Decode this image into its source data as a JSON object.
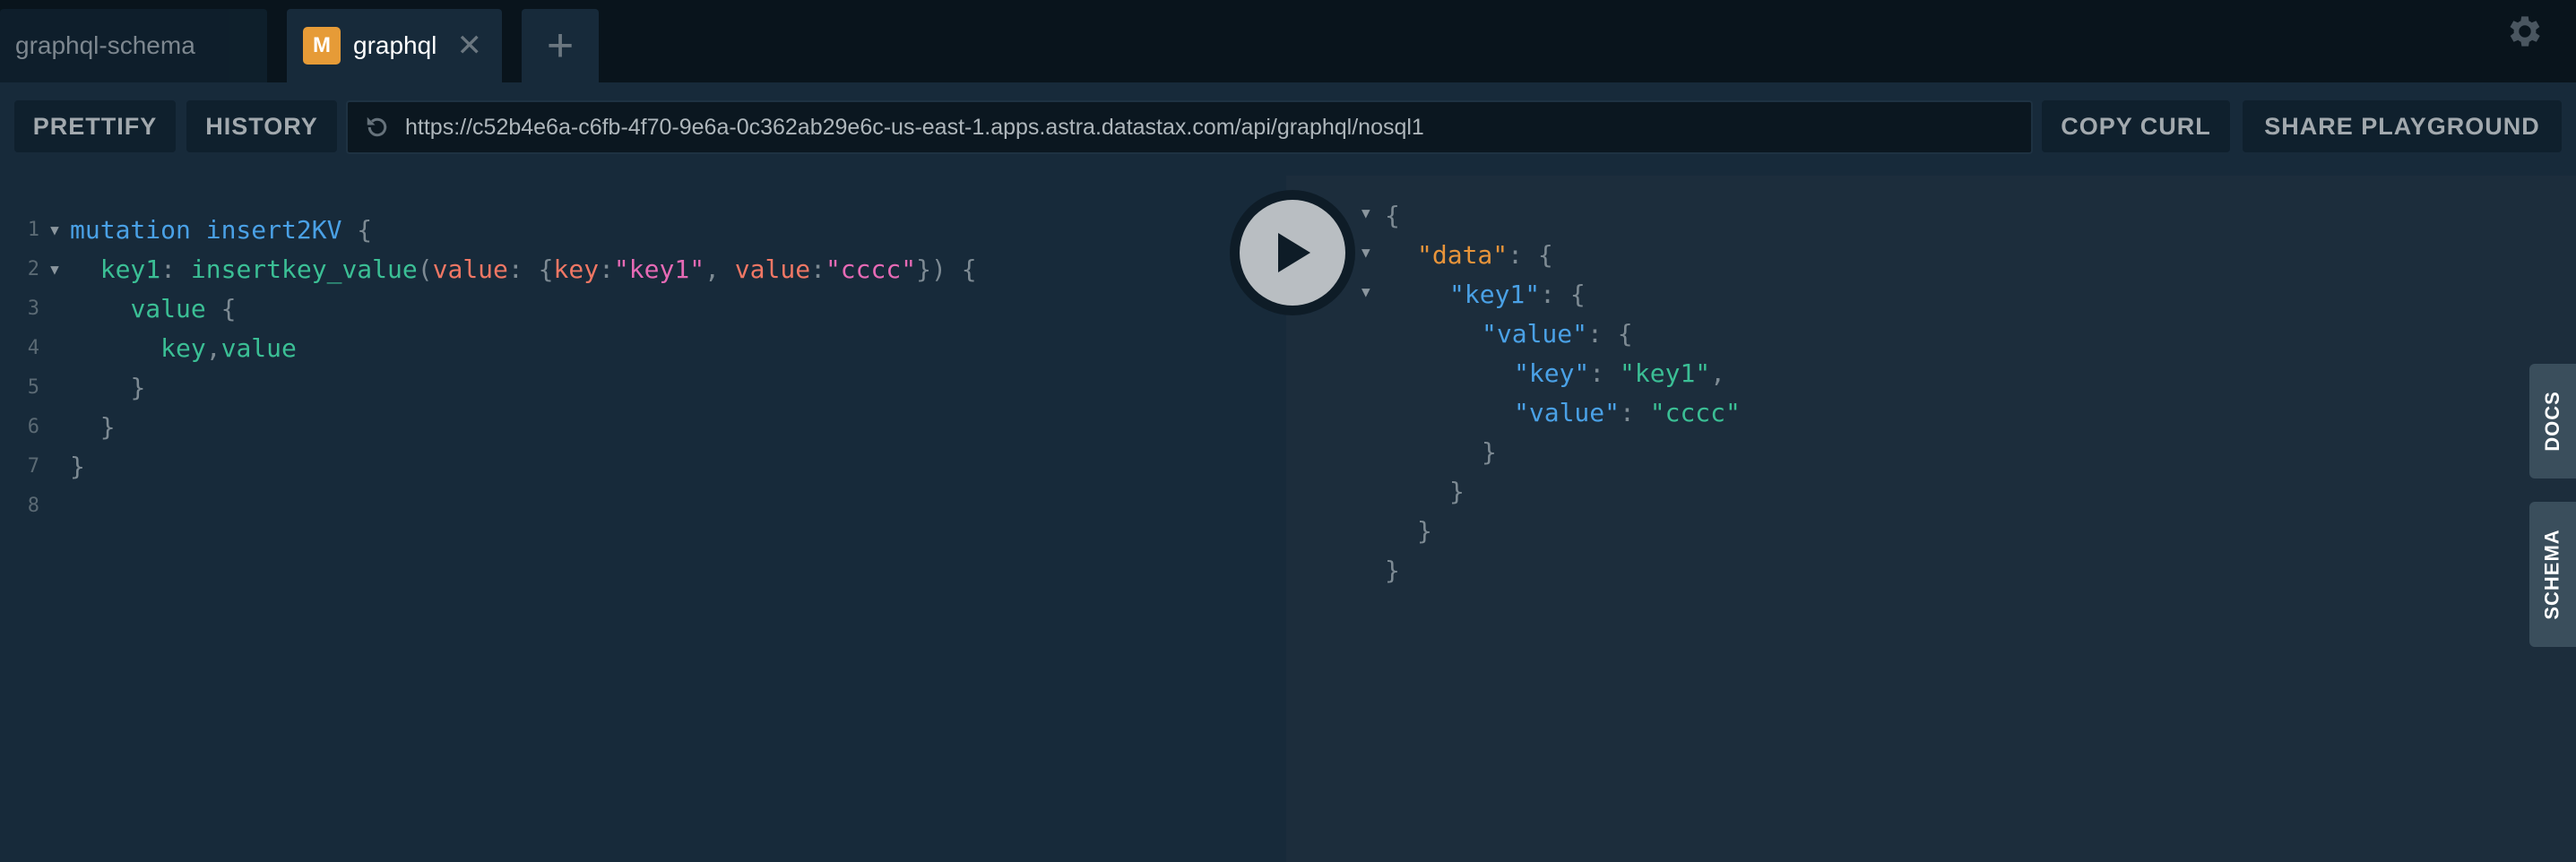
{
  "tabs": [
    {
      "label": "graphql-schema",
      "active": false
    },
    {
      "label": "graphql",
      "active": true,
      "badge": "M"
    }
  ],
  "tab_close_glyph": "✕",
  "add_tab_glyph": "+",
  "icons": {
    "settings": "gear-icon",
    "reload": "reload-icon",
    "play": "play-icon"
  },
  "toolbar": {
    "prettify": "PRETTIFY",
    "history": "HISTORY",
    "url": "https://c52b4e6a-c6fb-4f70-9e6a-0c362ab29e6c-us-east-1.apps.astra.datastax.com/api/graphql/nosql1",
    "copy_curl": "COPY CURL",
    "share": "SHARE PLAYGROUND"
  },
  "editor": {
    "line_numbers": [
      "1",
      "2",
      "3",
      "4",
      "5",
      "6",
      "7",
      "8"
    ],
    "l1": {
      "kw": "mutation",
      "name": "insert2KV",
      "brace": "{"
    },
    "l2": {
      "alias": "key1",
      "colon": ":",
      "field": "insertkey_value",
      "open": "(",
      "arg": "value",
      "argcolon": ":",
      "objopen": "{",
      "k": "key",
      "kc": ":",
      "kv": "\"key1\"",
      "comma": ",",
      "v": "value",
      "vc": ":",
      "vv": "\"cccc\"",
      "close": "})",
      "brace": "{"
    },
    "l3": {
      "field": "value",
      "brace": "{"
    },
    "l4": {
      "f1": "key",
      "comma": ",",
      "f2": "value"
    },
    "l5": "}",
    "l6": "}",
    "l7": "}"
  },
  "result": {
    "r1": "{",
    "r2": {
      "key": "\"data\"",
      "rest": ": {"
    },
    "r3": {
      "key": "\"key1\"",
      "rest": ": {"
    },
    "r4": {
      "key": "\"value\"",
      "rest": ": {"
    },
    "r5": {
      "key": "\"key\"",
      "colon": ": ",
      "val": "\"key1\"",
      "comma": ","
    },
    "r6": {
      "key": "\"value\"",
      "colon": ": ",
      "val": "\"cccc\""
    },
    "r7": "}",
    "r8": "}",
    "r9": "}",
    "r10": "}"
  },
  "side_tabs": {
    "docs": "DOCS",
    "schema": "SCHEMA"
  },
  "colors": {
    "accent_badge": "#e69b37",
    "keyword": "#4aa1e6",
    "field": "#3bbf95",
    "arg": "#f07764",
    "string": "#e66ab5",
    "json_key_top": "#e8943a"
  }
}
